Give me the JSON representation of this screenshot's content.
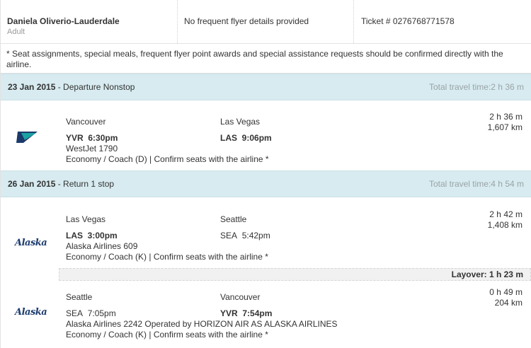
{
  "passenger": {
    "name": "Daniela Oliverio-Lauderdale",
    "type": "Adult",
    "frequent_flyer": "No frequent flyer details provided",
    "ticket": "Ticket # 0276768771578"
  },
  "notice": "* Seat assignments, special meals, frequent flyer point awards and special assistance requests should be confirmed directly with the airline.",
  "journeys": [
    {
      "date": "23 Jan 2015",
      "label": " - Departure Nonstop",
      "total": "Total travel time:2 h 36 m",
      "segments": [
        {
          "logo": "westjet-logo",
          "from_city": "Vancouver",
          "from_code": "YVR",
          "from_time": "6:30pm",
          "to_city": "Las Vegas",
          "to_code": "LAS",
          "to_time": "9:06pm",
          "flight": "WestJet  1790",
          "cabin": "Economy / Coach (D) | Confirm seats with the airline *",
          "duration": "2 h 36 m",
          "distance": "1,607 km"
        }
      ]
    },
    {
      "date": "26 Jan 2015",
      "label": " - Return 1 stop",
      "total": "Total travel time:4 h 54 m",
      "segments": [
        {
          "logo": "Alaska",
          "from_city": "Las Vegas",
          "from_code": "LAS",
          "from_time": "3:00pm",
          "to_city": "Seattle",
          "to_code": "SEA",
          "to_time": "5:42pm",
          "flight": "Alaska Airlines  609",
          "cabin": "Economy / Coach (K) | Confirm seats with the airline *",
          "duration": "2 h 42 m",
          "distance": "1,408 km"
        },
        {
          "logo": "Alaska",
          "from_city": "Seattle",
          "from_code": "SEA",
          "from_time": "7:05pm",
          "to_city": "Vancouver",
          "to_code": "YVR",
          "to_time": "7:54pm",
          "flight": "Alaska Airlines  2242 Operated by HORIZON AIR AS ALASKA AIRLINES",
          "cabin": "Economy / Coach (K) | Confirm seats with the airline *",
          "duration": "0 h 49 m",
          "distance": "204 km"
        }
      ],
      "layover": "Layover: 1 h 23 m"
    }
  ],
  "colors": {
    "header_bg": "#d7ebf0",
    "westjet_teal": "#1aa3a3",
    "westjet_navy": "#1b3a6b",
    "alaska_navy": "#1c3b6e"
  }
}
